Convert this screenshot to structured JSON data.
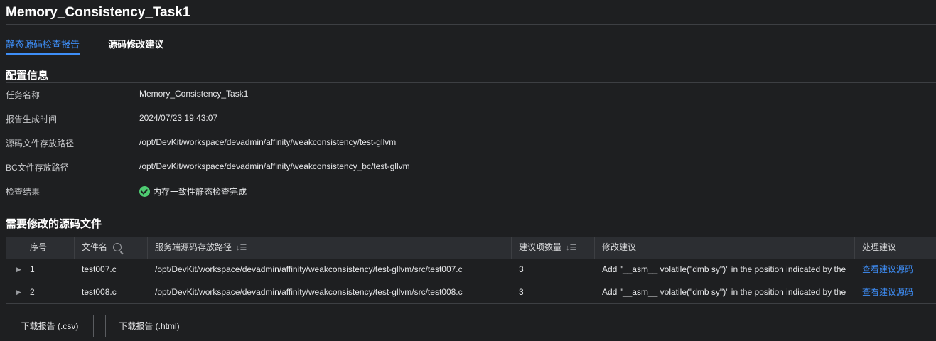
{
  "header": {
    "title": "Memory_Consistency_Task1"
  },
  "tabs": [
    {
      "label": "静态源码检查报告",
      "active": true
    },
    {
      "label": "源码修改建议",
      "active": false
    }
  ],
  "config": {
    "title": "配置信息",
    "rows": [
      {
        "label": "任务名称",
        "value": "Memory_Consistency_Task1"
      },
      {
        "label": "报告生成时间",
        "value": "2024/07/23 19:43:07"
      },
      {
        "label": "源码文件存放路径",
        "value": "/opt/DevKit/workspace/devadmin/affinity/weakconsistency/test-gllvm"
      },
      {
        "label": "BC文件存放路径",
        "value": "/opt/DevKit/workspace/devadmin/affinity/weakconsistency_bc/test-gllvm"
      },
      {
        "label": "检查结果",
        "value": "内存一致性静态检查完成",
        "status_icon": "check-circle-icon"
      }
    ]
  },
  "files": {
    "title": "需要修改的源码文件",
    "columns": {
      "index": "序号",
      "filename": "文件名",
      "path": "服务端源码存放路径",
      "count": "建议项数量",
      "suggestion": "修改建议",
      "action": "处理建议"
    },
    "rows": [
      {
        "index": "1",
        "filename": "test007.c",
        "path": "/opt/DevKit/workspace/devadmin/affinity/weakconsistency/test-gllvm/src/test007.c",
        "count": "3",
        "suggestion": "Add \"__asm__ volatile(\"dmb sy\")\" in the position indicated by the",
        "action": "查看建议源码"
      },
      {
        "index": "2",
        "filename": "test008.c",
        "path": "/opt/DevKit/workspace/devadmin/affinity/weakconsistency/test-gllvm/src/test008.c",
        "count": "3",
        "suggestion": "Add \"__asm__ volatile(\"dmb sy\")\" in the position indicated by the",
        "action": "查看建议源码"
      }
    ]
  },
  "buttons": {
    "download_csv": "下载报告 (.csv)",
    "download_html": "下载报告 (.html)"
  },
  "colors": {
    "background": "#1e1f21",
    "accent": "#3e8ef7",
    "success": "#4ecb71"
  }
}
